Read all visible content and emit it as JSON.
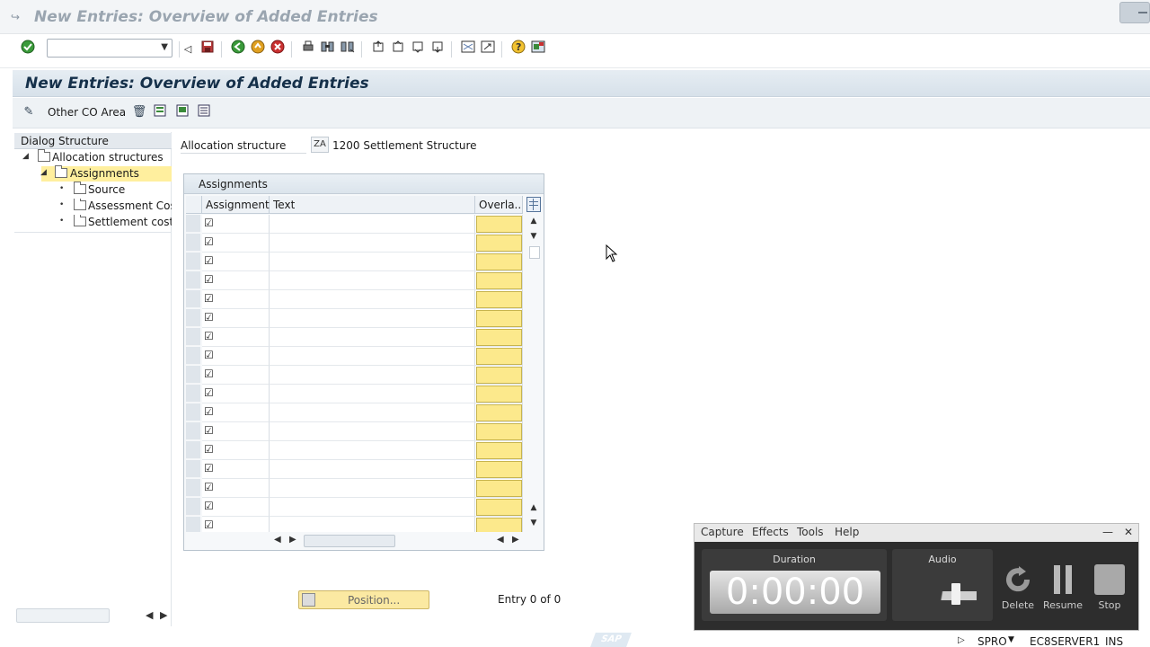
{
  "window": {
    "title": "New Entries: Overview of Added Entries"
  },
  "toolbar": {
    "command_field_value": ""
  },
  "screen_header": {
    "title": "New Entries: Overview of Added Entries"
  },
  "app_toolbar": {
    "other_co_area_label": "Other CO Area"
  },
  "dialog_structure": {
    "title": "Dialog Structure",
    "nodes": [
      {
        "label": "Allocation structures"
      },
      {
        "label": "Assignments"
      },
      {
        "label": "Source"
      },
      {
        "label": "Assessment Cost"
      },
      {
        "label": "Settlement cost"
      }
    ]
  },
  "allocation_structure": {
    "label": "Allocation structure",
    "key": "ZA",
    "value": "1200 Settlement Structure"
  },
  "assignments_table": {
    "title": "Assignments",
    "columns": [
      "Assignment",
      "Text",
      "Overla..."
    ]
  },
  "footer": {
    "position_button_label": "Position...",
    "entry_text": "Entry 0 of 0"
  },
  "recorder": {
    "menu": [
      "Capture",
      "Effects",
      "Tools",
      "Help"
    ],
    "duration_label": "Duration",
    "duration_value": "0:00:00",
    "audio_label": "Audio",
    "delete_label": "Delete",
    "resume_label": "Resume",
    "stop_label": "Stop"
  },
  "statusbar": {
    "transaction": "SPRO",
    "server": "EC8SERVER1",
    "mode": "INS"
  },
  "colors": {
    "header_title": "#15304a",
    "selected_node": "#ffef9e",
    "required_cell": "#fce98c"
  }
}
